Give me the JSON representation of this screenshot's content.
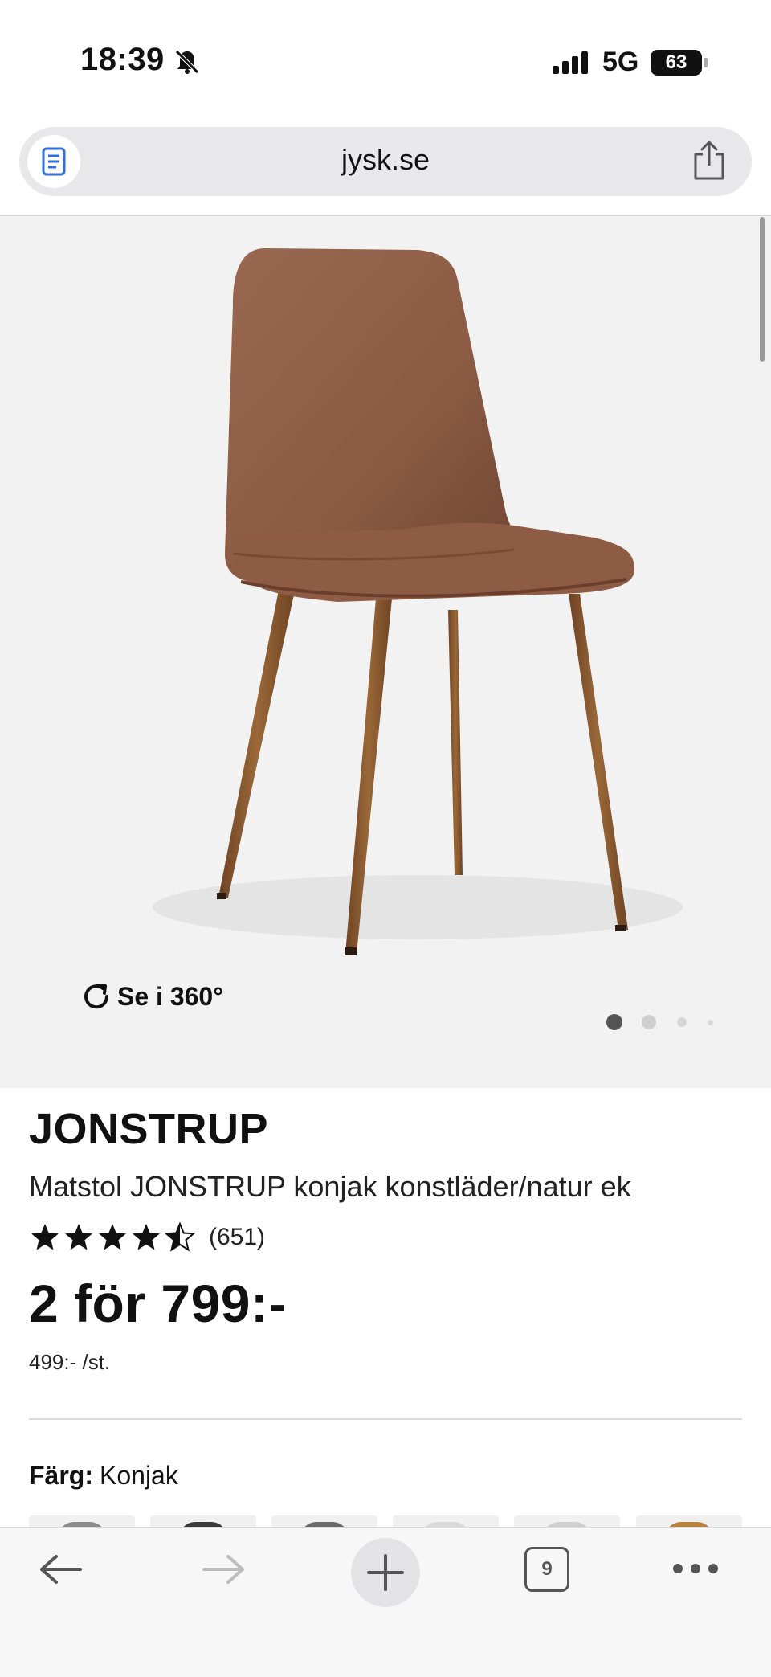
{
  "status_bar": {
    "time": "18:39",
    "network": "5G",
    "battery": "63"
  },
  "browser": {
    "url": "jysk.se",
    "tab_count": "9"
  },
  "product": {
    "view_360_label": "Se i 360°",
    "carousel": {
      "total": 4,
      "active": 1
    },
    "brand": "JONSTRUP",
    "title": "Matstol JONSTRUP konjak konstläder/natur ek",
    "rating_value": 4.5,
    "rating_count": "(651)",
    "price": "2 för 799:-",
    "unit_price": "499:- /st.",
    "color_label": "Färg:",
    "color_value": "Konjak",
    "swatch_colors": [
      "#8b8b8b",
      "#3a3a3a",
      "#6a6a6a",
      "#d8d8d8",
      "#cfcfcf",
      "#b8823e"
    ]
  },
  "colors": {
    "chair_leather": "#8a5a42",
    "chair_legs": "#8b5a32",
    "background": "#f2f2f2"
  }
}
